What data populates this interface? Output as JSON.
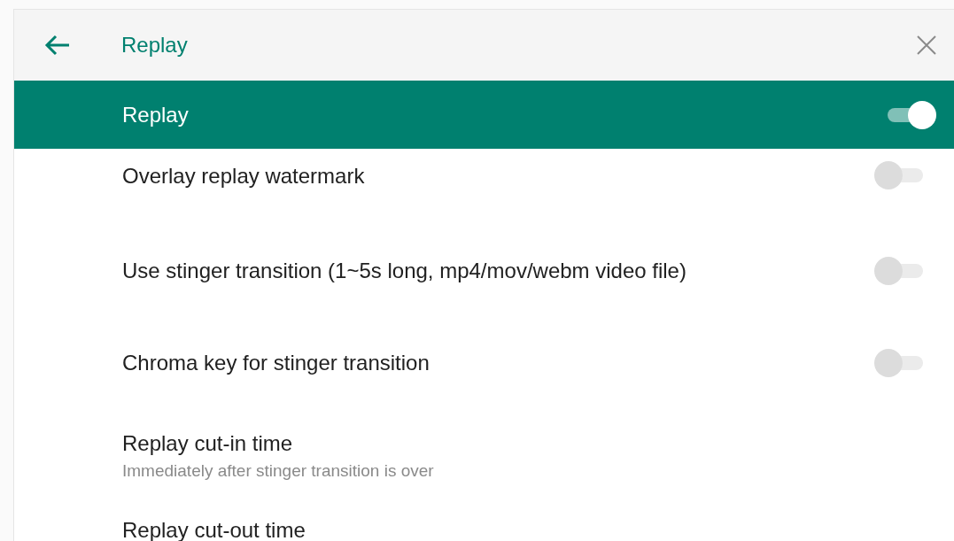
{
  "header": {
    "title": "Replay"
  },
  "master": {
    "label": "Replay",
    "on": true
  },
  "rows": [
    {
      "kind": "toggle",
      "label": "Overlay replay watermark",
      "on": false
    },
    {
      "kind": "toggle",
      "label": "Use stinger transition (1~5s long, mp4/mov/webm video file)",
      "on": false
    },
    {
      "kind": "toggle",
      "label": "Chroma key for stinger transition",
      "on": false
    },
    {
      "kind": "detail",
      "label": "Replay cut-in time",
      "value": "Immediately after stinger transition is over"
    },
    {
      "kind": "detail",
      "label": "Replay cut-out time"
    }
  ]
}
